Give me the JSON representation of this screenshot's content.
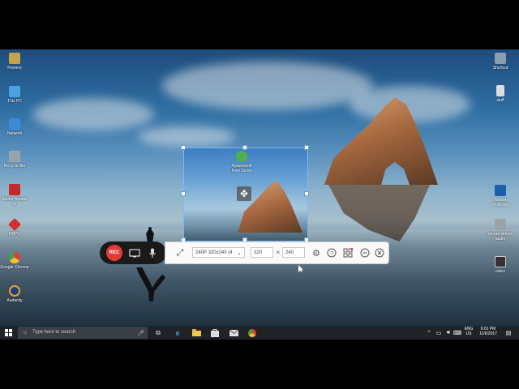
{
  "desktop_icons_left": [
    {
      "label": "Flowers",
      "icon": "folder-icon",
      "color": "#c7a34a"
    },
    {
      "label": "This PC",
      "icon": "pc-icon",
      "color": "#4aa3e0"
    },
    {
      "label": "Network",
      "icon": "network-icon",
      "color": "#3c8ad8"
    },
    {
      "label": "Recycle Bin",
      "icon": "recycle-bin-icon",
      "color": "#9aa3aa"
    },
    {
      "label": "Adobe Reader XI",
      "icon": "pdf-icon",
      "color": "#c62828"
    },
    {
      "label": "DRPU",
      "icon": "drpu-icon",
      "color": "#d32f2f"
    },
    {
      "label": "Google Chrome",
      "icon": "chrome-icon",
      "color": "#4caf50"
    },
    {
      "label": "Audacity",
      "icon": "headphones-icon",
      "color": "#f0a020"
    }
  ],
  "desktop_icons_right": [
    {
      "label": "Shortcut",
      "icon": "shortcut-icon",
      "color": "#8aa0b0"
    },
    {
      "label": "stuff",
      "icon": "file-icon",
      "color": "#dddddd"
    },
    {
      "label": "Adobe Photoshop",
      "icon": "photoshop-icon",
      "color": "#1d5ea8"
    },
    {
      "label": "record videos audio",
      "icon": "recorder-icon",
      "color": "#9aa3aa"
    },
    {
      "label": "video",
      "icon": "video-icon",
      "color": "#333333"
    }
  ],
  "region_icon": {
    "label": "Apowersoft Free Scree",
    "icon": "apowersoft-icon"
  },
  "toolbar": {
    "rec_label": "REC",
    "resolution": "240P 320x240 (4",
    "width": "320",
    "times": "×",
    "height": "240"
  },
  "taskbar": {
    "search_placeholder": "Type here to search",
    "lang_top": "ENG",
    "lang_bottom": "US",
    "time": "6:01 PM",
    "date": "11/6/2017"
  }
}
